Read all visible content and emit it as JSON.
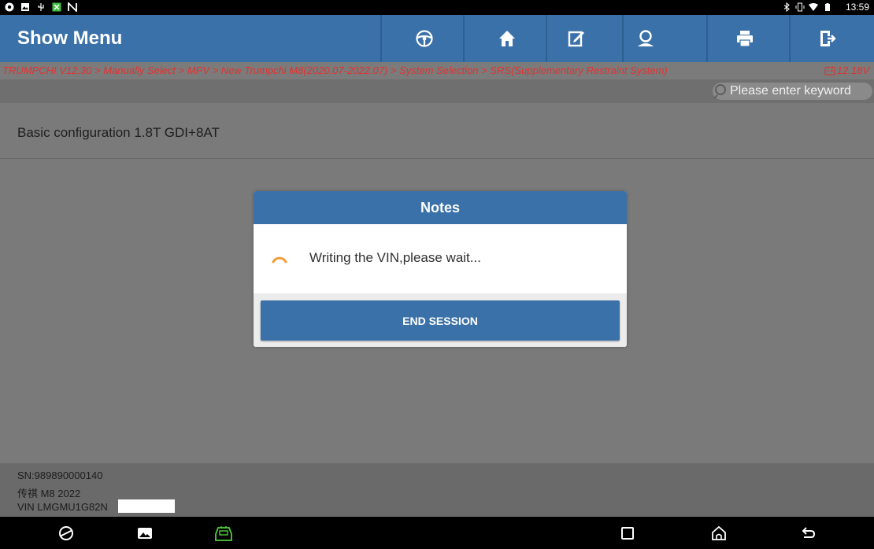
{
  "status_bar": {
    "clock": "13:59",
    "left_icons": [
      "chrome-icon",
      "gallery-icon",
      "usb-icon",
      "app-icon",
      "nfc-icon"
    ],
    "right_icons": [
      "bluetooth-icon",
      "vibrate-icon",
      "wifi-icon",
      "battery-icon"
    ]
  },
  "header": {
    "title": "Show Menu",
    "buttons": [
      "steering-wheel-icon",
      "home-icon",
      "edit-icon",
      "user-icon",
      "print-icon",
      "exit-icon"
    ]
  },
  "breadcrumb": {
    "path": "TRUMPCHI V12.30 > Manually Select > MPV > New Trumpchi M8(2020.07-2022.07) > System Selection > SRS(Supplementary Restraint System)",
    "voltage": "12.18V"
  },
  "search": {
    "placeholder": "Please enter keyword"
  },
  "config": {
    "label": "Basic configuration  1.8T GDI+8AT"
  },
  "vehicle_info": {
    "sn": "SN:989890000140",
    "model": "传祺 M8 2022",
    "vin": "VIN LMGMU1G82N"
  },
  "dialog": {
    "title": "Notes",
    "message": "Writing the VIN,please wait...",
    "button_label": "END SESSION"
  },
  "colors": {
    "header_blue": "#3b71a9",
    "breadcrumb_red": "#e13232",
    "spinner_orange": "#f29a3a",
    "vci_green": "#4fcf3c"
  },
  "nav_bar": {
    "buttons": [
      "browser-icon",
      "gallery-icon",
      "vci-icon",
      "recents-icon",
      "home-nav-icon",
      "back-icon"
    ]
  }
}
